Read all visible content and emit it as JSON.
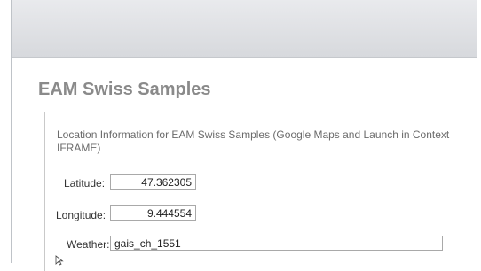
{
  "page": {
    "title": "EAM Swiss Samples",
    "description": "Location Information for EAM Swiss Samples (Google Maps and Launch in Context IFRAME)"
  },
  "fields": {
    "latitude": {
      "label": "Latitude:",
      "value": "47.362305"
    },
    "longitude": {
      "label": "Longitude:",
      "value": "9.444554"
    },
    "weather": {
      "label": "Weather:",
      "value": "gais_ch_1551"
    }
  }
}
